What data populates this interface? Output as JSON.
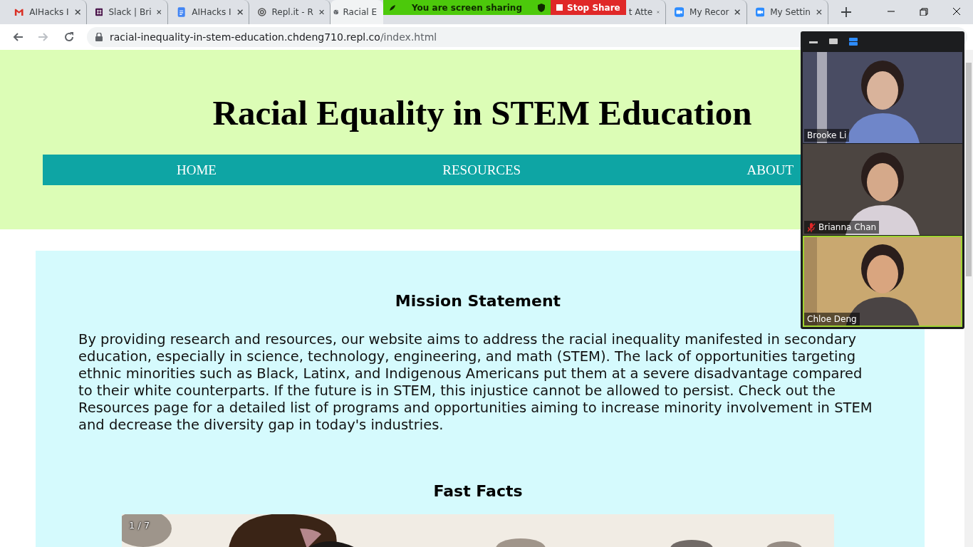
{
  "browser": {
    "tabs": [
      {
        "label": "AIHacks I",
        "selected": false
      },
      {
        "label": "Slack | Bri",
        "selected": false
      },
      {
        "label": "AIHacks I",
        "selected": false
      },
      {
        "label": "Repl.it - R",
        "selected": false
      },
      {
        "label": "Racial E",
        "selected": true
      },
      {
        "label": "t Atte",
        "selected": false
      },
      {
        "label": "My Recor",
        "selected": false
      },
      {
        "label": "My Settin",
        "selected": false
      }
    ],
    "address": {
      "host": "racial-inequality-in-stem-education.chdeng710.repl.co",
      "path": "/index.html"
    }
  },
  "share_banner": {
    "status": "You are screen sharing",
    "stop": "Stop Share"
  },
  "site": {
    "title": "Racial Equality in STEM Education",
    "nav": [
      {
        "label": "HOME"
      },
      {
        "label": "RESOURCES"
      },
      {
        "label": "ABOUT"
      }
    ],
    "mission": {
      "heading": "Mission Statement",
      "text": "By providing research and resources, our website aims to address the racial inequality manifested in secondary education, especially in science, technology, engineering, and math (STEM). The lack of opportunities targeting ethnic minorities such as Black, Latinx, and Indigenous Americans put them at a severe disadvantage compared to their white counterparts. If the future is in STEM, this injustice cannot be allowed to persist. Check out the Resources page for a detailed list of programs and opportunities aiming to increase minority involvement in STEM and decrease the diversity gap in today's industries."
    },
    "facts": {
      "heading": "Fast Facts",
      "counter": "1 / 7"
    }
  },
  "meeting": {
    "participants": [
      {
        "name": "Brooke Li",
        "muted": false,
        "speaking": false
      },
      {
        "name": "Brianna Chan",
        "muted": true,
        "speaking": false
      },
      {
        "name": "Chloe Deng",
        "muted": false,
        "speaking": true
      }
    ]
  }
}
